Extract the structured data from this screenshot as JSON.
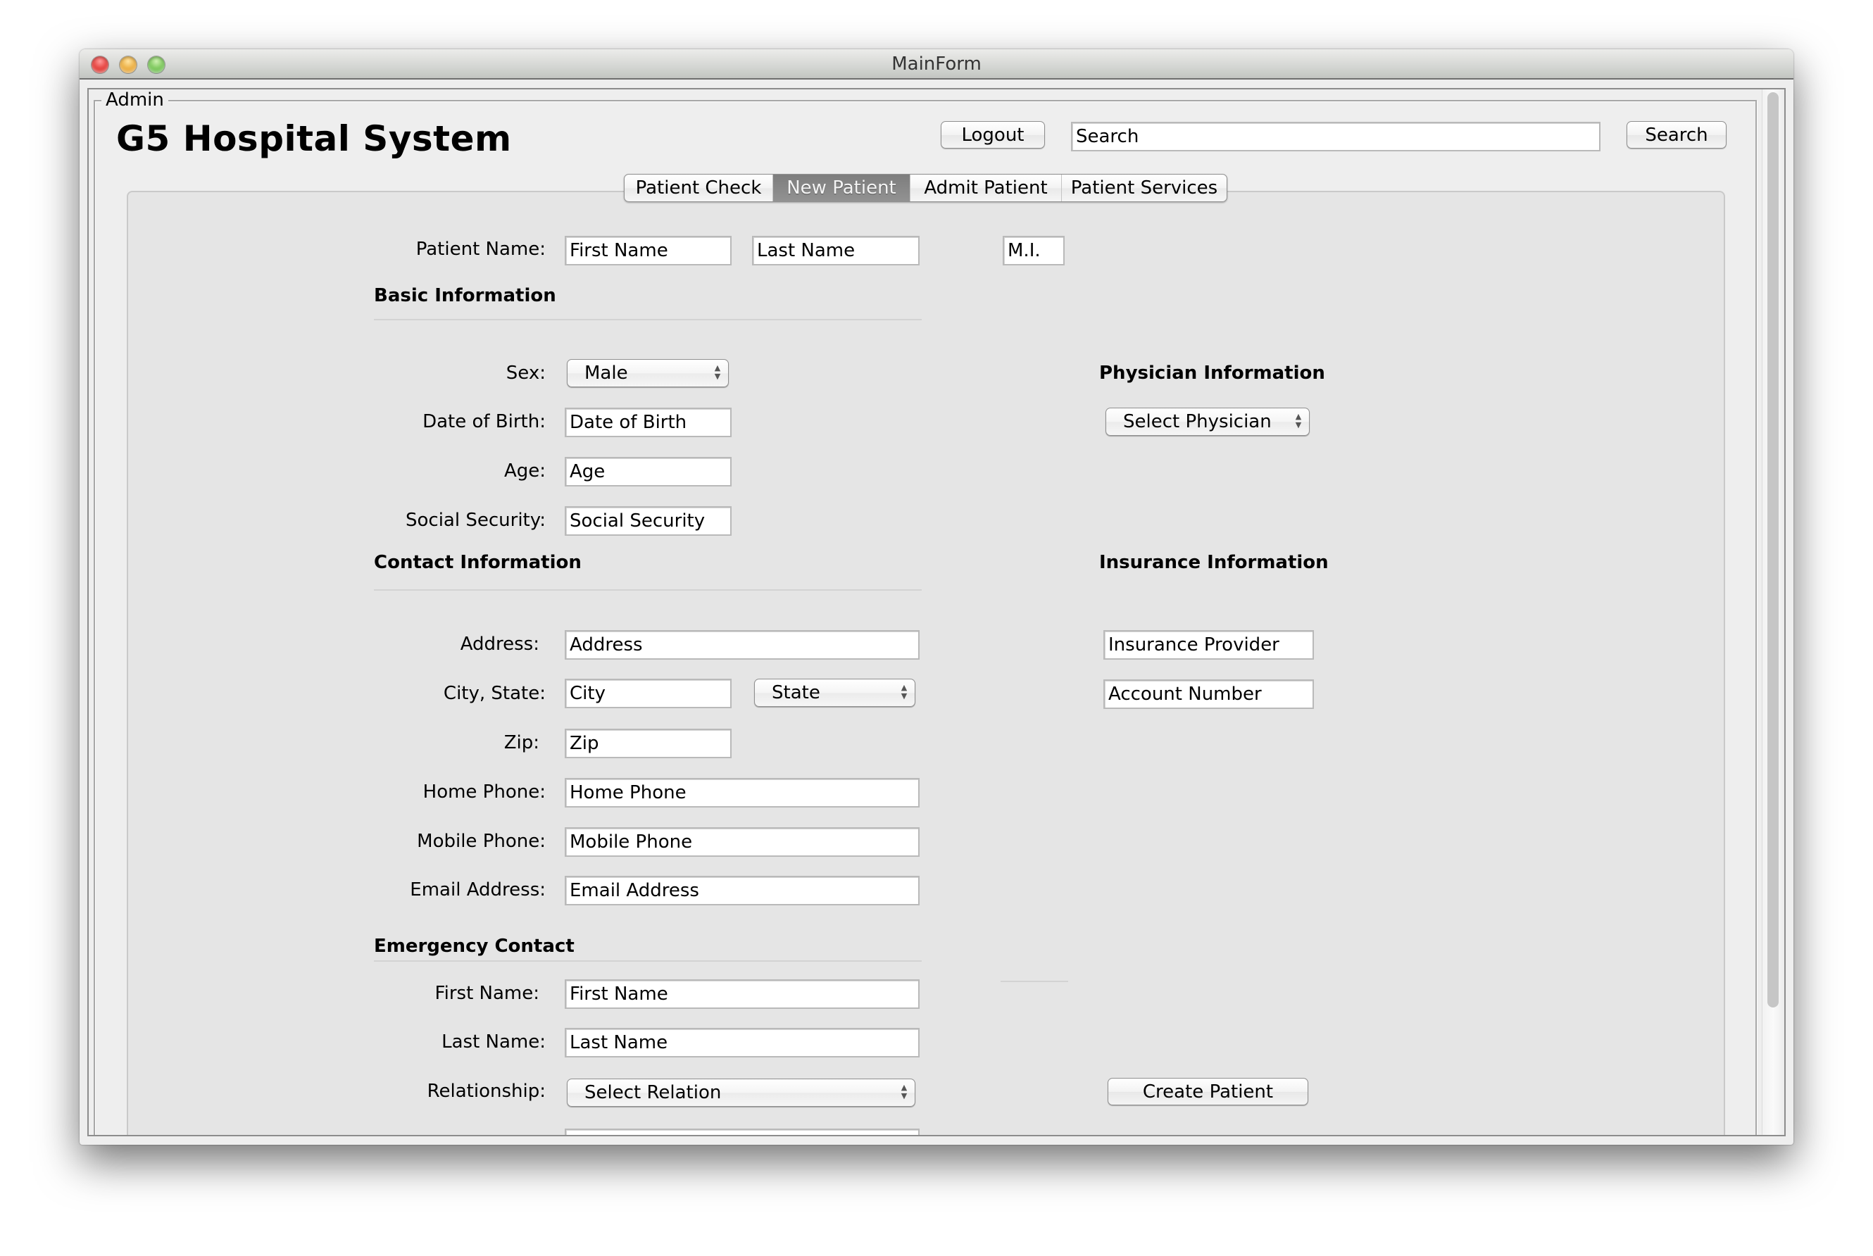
{
  "window": {
    "title": "MainForm",
    "controls": [
      "close",
      "minimize",
      "maximize"
    ]
  },
  "panel": {
    "border_title": "Admin",
    "app_title": "G5 Hospital System"
  },
  "header": {
    "logout_label": "Logout",
    "search_value": "Search",
    "search_button_label": "Search"
  },
  "tabs": [
    {
      "label": "Patient Check",
      "active": false
    },
    {
      "label": "New Patient",
      "active": true
    },
    {
      "label": "Admit Patient",
      "active": false
    },
    {
      "label": "Patient Services",
      "active": false
    }
  ],
  "form": {
    "patient_name": {
      "label": "Patient Name:",
      "first": "First Name",
      "last": "Last Name",
      "mi": "M.I."
    },
    "basic": {
      "heading": "Basic Information",
      "sex_label": "Sex:",
      "sex_value": "Male",
      "dob_label": "Date of Birth:",
      "dob_value": "Date of Birth",
      "age_label": "Age:",
      "age_value": "Age",
      "ssn_label": "Social Security:",
      "ssn_value": "Social Security"
    },
    "contact": {
      "heading": "Contact Information",
      "address_label": "Address:",
      "address_value": "Address",
      "city_state_label": "City, State:",
      "city_value": "City",
      "state_value": "State",
      "zip_label": "Zip:",
      "zip_value": "Zip",
      "home_phone_label": "Home Phone:",
      "home_phone_value": "Home Phone",
      "mobile_phone_label": "Mobile Phone:",
      "mobile_phone_value": "Mobile Phone",
      "email_label": "Email Address:",
      "email_value": "Email Address"
    },
    "emergency": {
      "heading": "Emergency Contact",
      "first_label": "First Name:",
      "first_value": "First Name",
      "last_label": "Last Name:",
      "last_value": "Last Name",
      "relationship_label": "Relationship:",
      "relationship_value": "Select Relation"
    },
    "physician": {
      "heading": "Physician Information",
      "select_value": "Select Physician"
    },
    "insurance": {
      "heading": "Insurance Information",
      "provider_value": "Insurance Provider",
      "account_value": "Account Number"
    },
    "create_button_label": "Create Patient"
  },
  "scroll": {
    "visible_fraction": 0.88,
    "position": 0
  },
  "icons": {
    "select_arrows": "▲▼"
  }
}
